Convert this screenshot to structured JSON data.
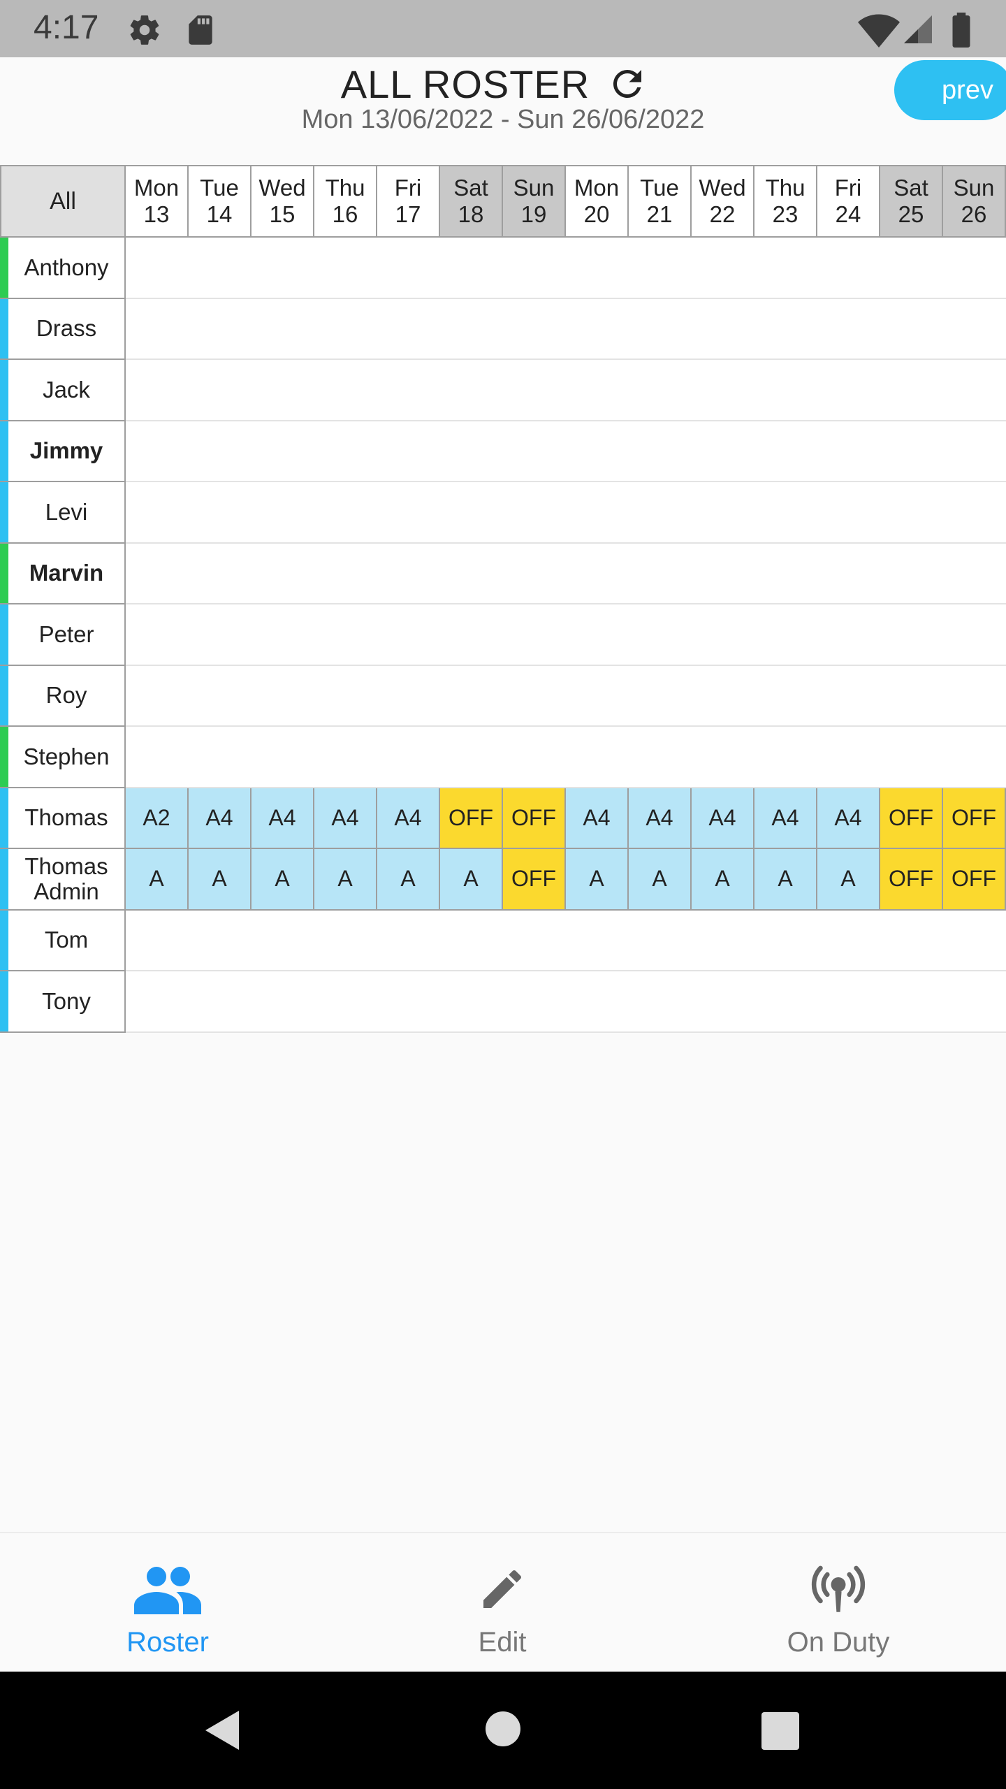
{
  "status_bar": {
    "time": "4:17",
    "icons": [
      "gear-icon",
      "sd-card-icon",
      "wifi-icon",
      "signal-icon",
      "battery-icon"
    ]
  },
  "header": {
    "title": "ALL ROSTER",
    "date_range": "Mon 13/06/2022 - Sun 26/06/2022",
    "prev_label": "prev",
    "refresh_icon": "refresh-icon"
  },
  "grid": {
    "all_label": "All",
    "days": [
      {
        "dow": "Mon",
        "date": "13",
        "weekend": false
      },
      {
        "dow": "Tue",
        "date": "14",
        "weekend": false
      },
      {
        "dow": "Wed",
        "date": "15",
        "weekend": false
      },
      {
        "dow": "Thu",
        "date": "16",
        "weekend": false
      },
      {
        "dow": "Fri",
        "date": "17",
        "weekend": false
      },
      {
        "dow": "Sat",
        "date": "18",
        "weekend": true
      },
      {
        "dow": "Sun",
        "date": "19",
        "weekend": true
      },
      {
        "dow": "Mon",
        "date": "20",
        "weekend": false
      },
      {
        "dow": "Tue",
        "date": "21",
        "weekend": false
      },
      {
        "dow": "Wed",
        "date": "22",
        "weekend": false
      },
      {
        "dow": "Thu",
        "date": "23",
        "weekend": false
      },
      {
        "dow": "Fri",
        "date": "24",
        "weekend": false
      },
      {
        "dow": "Sat",
        "date": "25",
        "weekend": true
      },
      {
        "dow": "Sun",
        "date": "26",
        "weekend": true
      }
    ],
    "staff": [
      {
        "name": "Anthony",
        "bold": false,
        "color": "#2ecc52",
        "shifts": []
      },
      {
        "name": "Drass",
        "bold": false,
        "color": "#2ec0f2",
        "shifts": []
      },
      {
        "name": "Jack",
        "bold": false,
        "color": "#2ec0f2",
        "shifts": []
      },
      {
        "name": "Jimmy",
        "bold": true,
        "color": "#2ec0f2",
        "shifts": []
      },
      {
        "name": "Levi",
        "bold": false,
        "color": "#2ec0f2",
        "shifts": []
      },
      {
        "name": "Marvin",
        "bold": true,
        "color": "#2ecc52",
        "shifts": []
      },
      {
        "name": "Peter",
        "bold": false,
        "color": "#2ec0f2",
        "shifts": []
      },
      {
        "name": "Roy",
        "bold": false,
        "color": "#2ec0f2",
        "shifts": []
      },
      {
        "name": "Stephen",
        "bold": false,
        "color": "#2ecc52",
        "shifts": []
      },
      {
        "name": "Thomas",
        "bold": false,
        "color": "#2ec0f2",
        "shifts": [
          "A2",
          "A4",
          "A4",
          "A4",
          "A4",
          "OFF",
          "OFF",
          "A4",
          "A4",
          "A4",
          "A4",
          "A4",
          "OFF",
          "OFF"
        ]
      },
      {
        "name": "Thomas\nAdmin",
        "bold": false,
        "color": "#2ec0f2",
        "shifts": [
          "A",
          "A",
          "A",
          "A",
          "A",
          "A",
          "OFF",
          "A",
          "A",
          "A",
          "A",
          "A",
          "OFF",
          "OFF"
        ]
      },
      {
        "name": "Tom",
        "bold": false,
        "color": "#2ec0f2",
        "shifts": []
      },
      {
        "name": "Tony",
        "bold": false,
        "color": "#2ec0f2",
        "shifts": []
      }
    ]
  },
  "bottom_nav": [
    {
      "label": "Roster",
      "icon": "people-icon",
      "active": true
    },
    {
      "label": "Edit",
      "icon": "pencil-icon",
      "active": false
    },
    {
      "label": "On Duty",
      "icon": "broadcast-icon",
      "active": false
    }
  ],
  "system_nav": [
    "back-icon",
    "home-icon",
    "recents-icon"
  ],
  "colors": {
    "accent": "#2196f3",
    "prev_button": "#2ec0f2",
    "work_shift": "#b7e5f7",
    "off_shift": "#fbd92e",
    "weekend_header": "#c8c8c8"
  }
}
